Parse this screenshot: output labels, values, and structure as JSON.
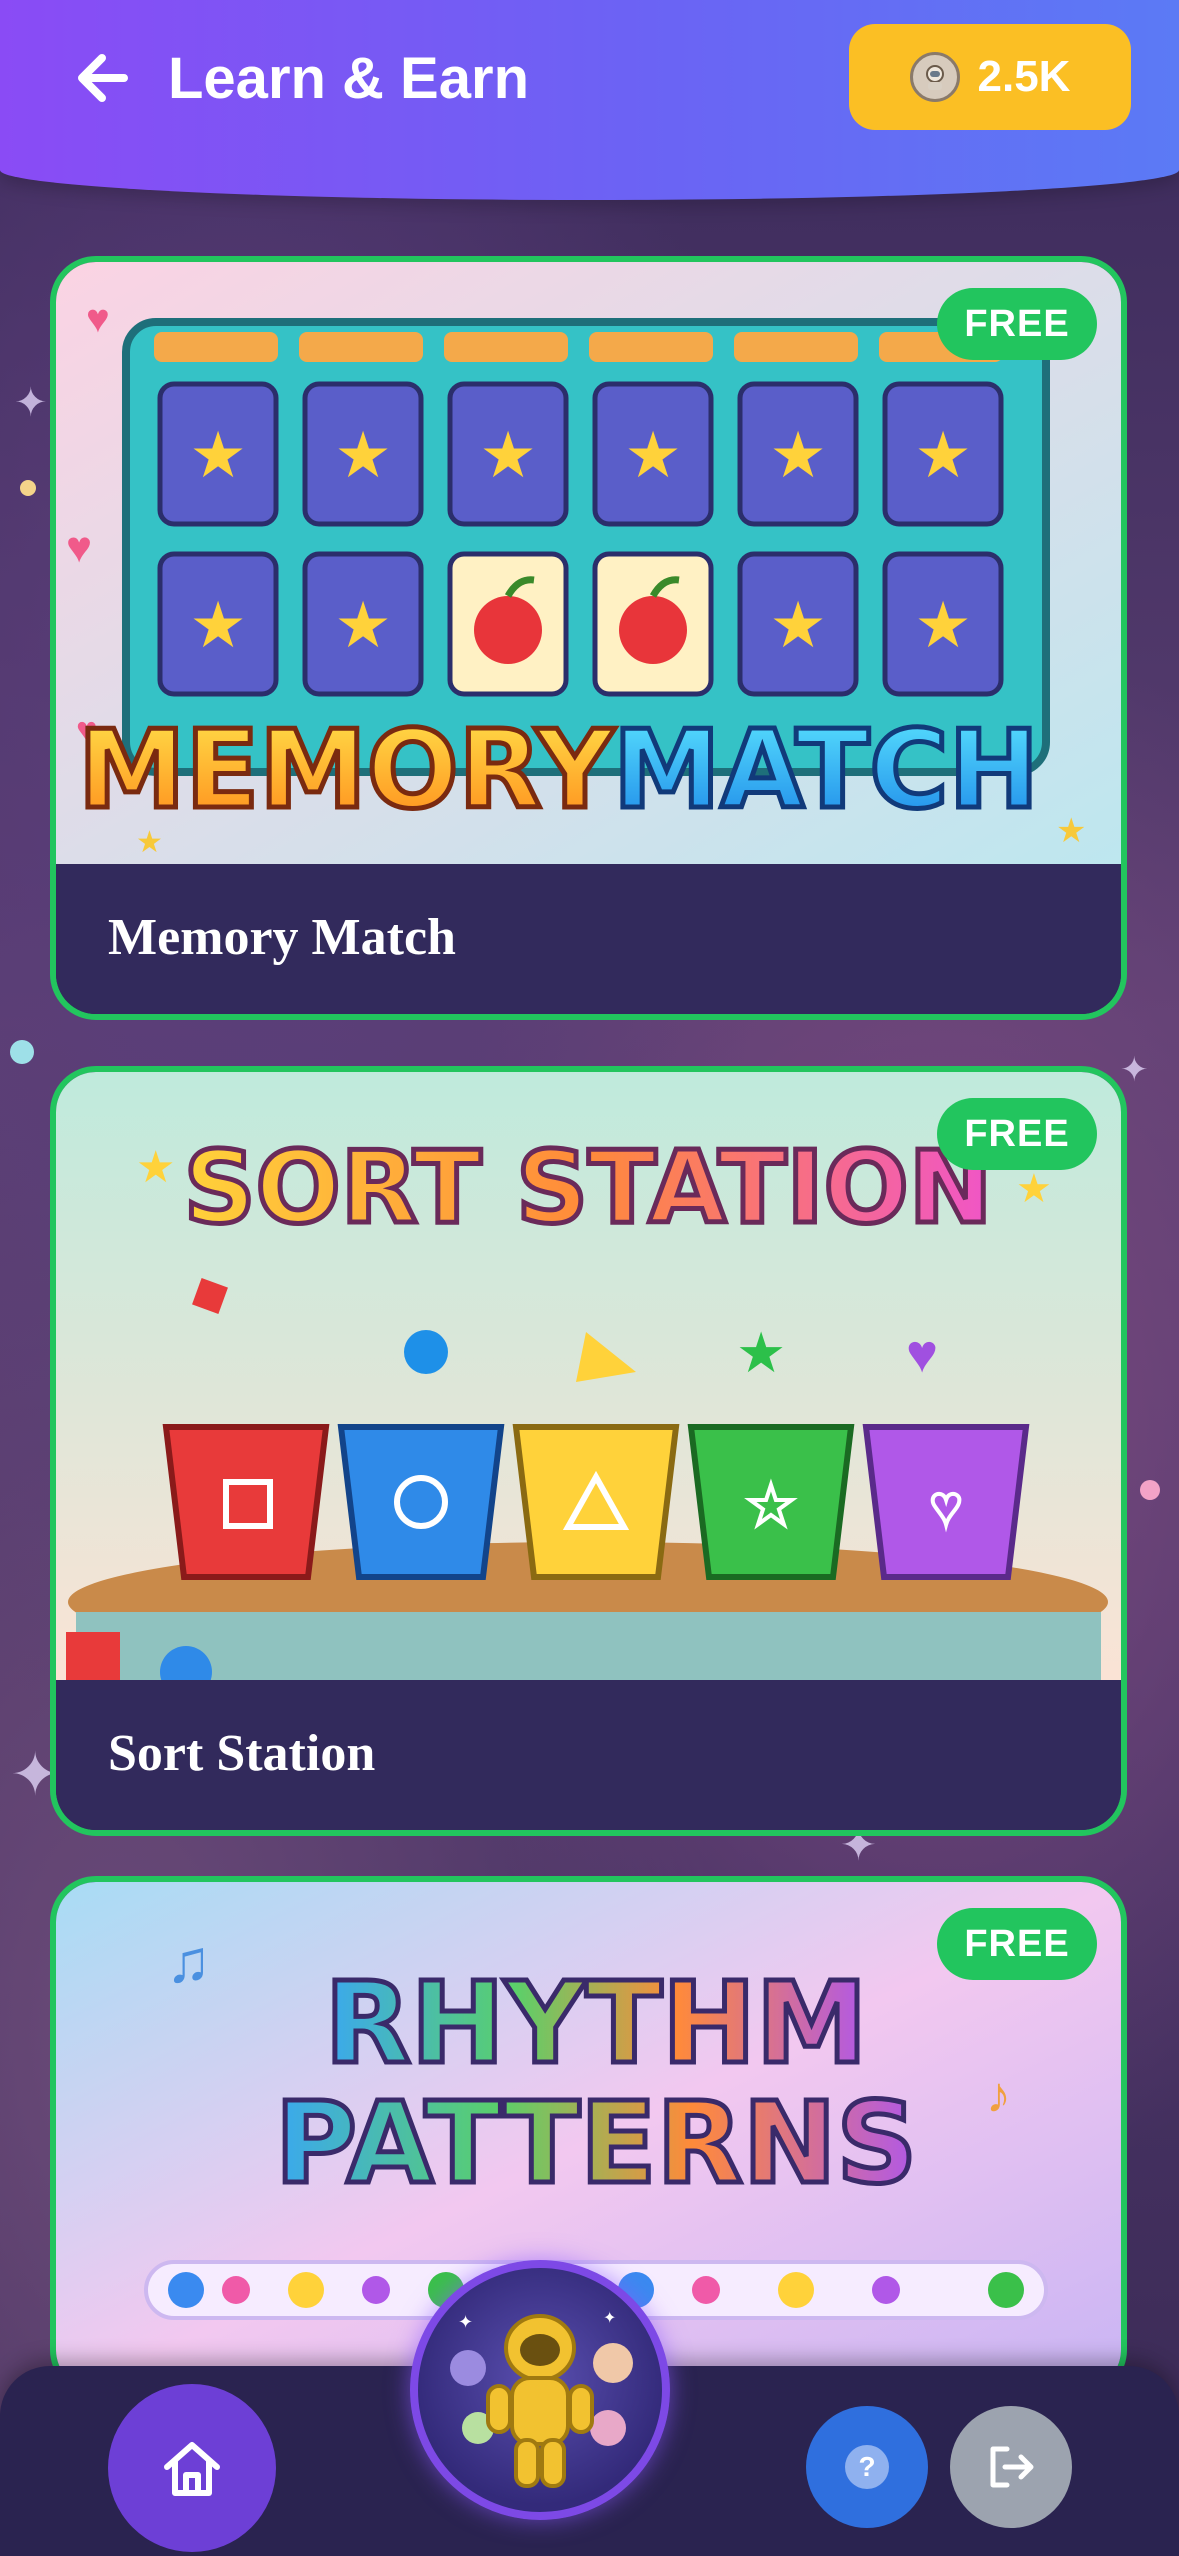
{
  "header": {
    "title": "Learn & Earn",
    "coins": "2.5K"
  },
  "games": [
    {
      "title": "Memory Match",
      "badge": "FREE",
      "art_text": [
        "MEMORY",
        "MATCH"
      ]
    },
    {
      "title": "Sort Station",
      "badge": "FREE",
      "art_text": [
        "SORT STATION"
      ]
    },
    {
      "title": "",
      "badge": "FREE",
      "art_text": [
        "RHYTHM",
        "PATTERNS"
      ]
    }
  ],
  "bottom_nav": {
    "home_icon": "home-icon",
    "center_icon": "astronaut-avatar",
    "help_icon": "help-icon",
    "help_text": "?",
    "logout_icon": "logout-icon"
  },
  "colors": {
    "header_start": "#8a4bf5",
    "header_end": "#5b7af5",
    "coin_pill": "#fbbf24",
    "card_border": "#22c55e",
    "badge": "#22c55e",
    "card_footer": "#322a5c",
    "nav_bg": "#2a2350",
    "home_btn": "#6d3fd6",
    "help_btn": "#2f6fde",
    "logout_btn": "#9ca3af"
  }
}
